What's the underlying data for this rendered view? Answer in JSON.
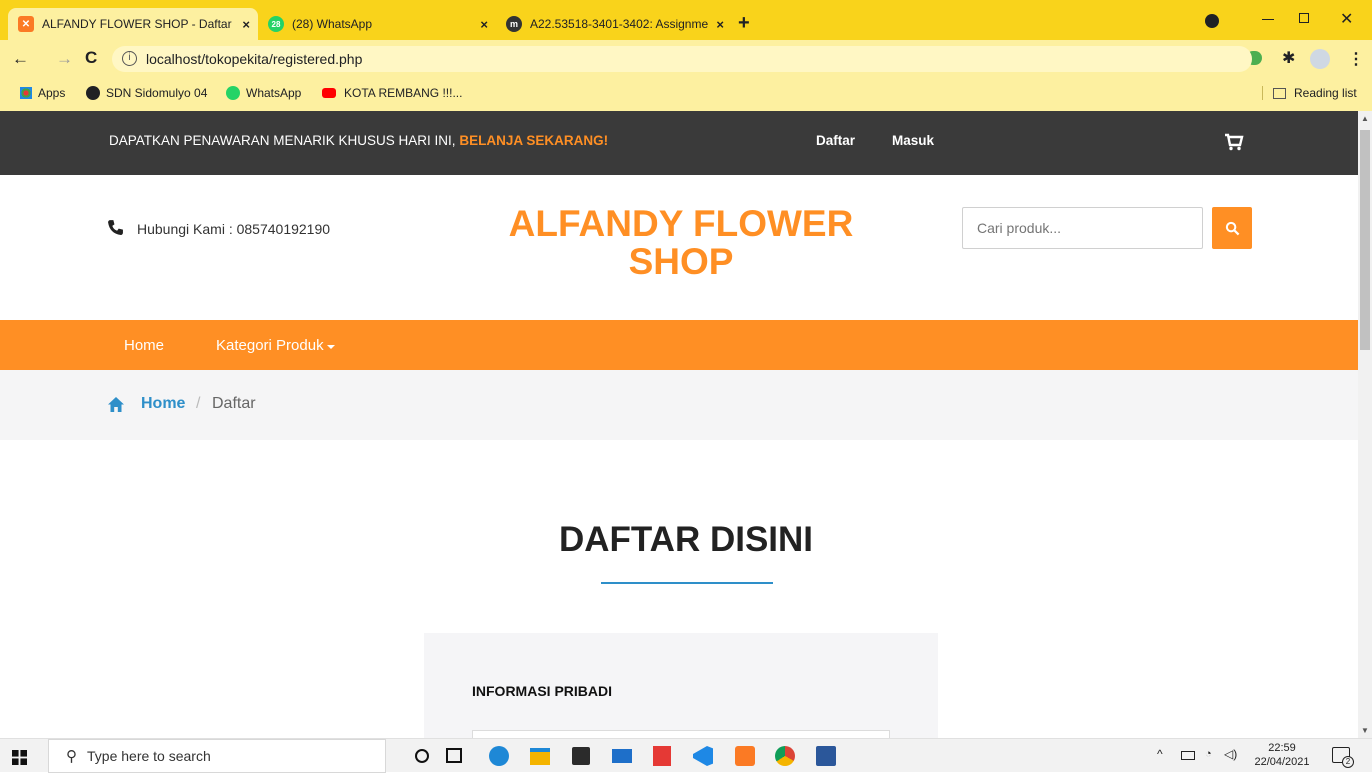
{
  "browser": {
    "tabs": [
      {
        "title": "ALFANDY FLOWER SHOP - Daftar",
        "icon": "xampp-icon"
      },
      {
        "title": "(28) WhatsApp",
        "icon": "whatsapp-icon",
        "badge": "28"
      },
      {
        "title": "A22.53518-3401-3402: Assignme",
        "icon": "moodle-icon"
      }
    ],
    "close_symbol": "×",
    "new_tab_symbol": "+",
    "url": "localhost/tokopekita/registered.php",
    "bookmarks": [
      {
        "label": "Apps",
        "icon": "apps-grid-icon"
      },
      {
        "label": "SDN Sidomulyo 04",
        "icon": "globe-icon"
      },
      {
        "label": "WhatsApp",
        "icon": "whatsapp-icon"
      },
      {
        "label": "KOTA REMBANG !!!...",
        "icon": "youtube-icon"
      }
    ],
    "reading_list": "Reading list"
  },
  "topbar": {
    "promo_text": "DAPATKAN PENAWARAN MENARIK KHUSUS HARI INI,",
    "promo_highlight": "BELANJA SEKARANG!",
    "register_link": "Daftar",
    "login_link": "Masuk"
  },
  "header": {
    "contact": "Hubungi Kami : 085740192190",
    "logo_line1": "ALFANDY FLOWER",
    "logo_line2": "SHOP",
    "search_placeholder": "Cari produk..."
  },
  "nav": {
    "home": "Home",
    "categories": "Kategori Produk"
  },
  "breadcrumb": {
    "home": "Home",
    "separator": "/",
    "current": "Daftar"
  },
  "main": {
    "title": "DAFTAR DISINI",
    "section_title": "INFORMASI PRIBADI"
  },
  "taskbar": {
    "search_placeholder": "Type here to search",
    "time": "22:59",
    "date": "22/04/2021",
    "notification_count": "2"
  },
  "colors": {
    "accent": "#ff8f24",
    "dark": "#3a3a3a",
    "chrome": "#f9d31b",
    "link_blue": "#2e8fc9"
  }
}
